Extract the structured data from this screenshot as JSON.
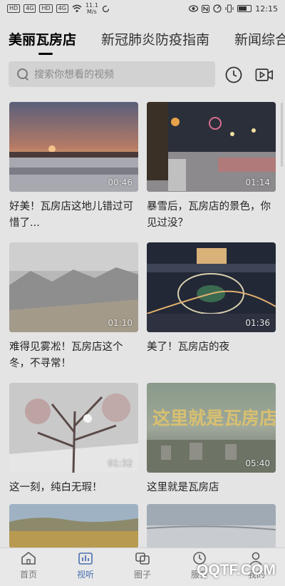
{
  "status_bar": {
    "left_chips": [
      "HD",
      "4G",
      "HD",
      "4G"
    ],
    "speed_value": "11.1",
    "speed_unit": "M/s",
    "time": "12:15"
  },
  "tabs": [
    {
      "label": "美丽瓦房店",
      "active": true
    },
    {
      "label": "新冠肺炎防疫指南",
      "active": false
    },
    {
      "label": "新闻综合",
      "active": false
    }
  ],
  "search": {
    "placeholder": "搜索你想看的视频"
  },
  "videos": [
    {
      "caption": "好美！瓦房店这地儿错过可惜了...",
      "duration": "00:46",
      "scene": "sunset-snow"
    },
    {
      "caption": "暴雪后，瓦房店的景色，你见过没？",
      "duration": "01:14",
      "scene": "night-snow-street"
    },
    {
      "caption": "难得见雾凇！瓦房店这个冬，不寻常！",
      "duration": "01:10",
      "scene": "frost-trees"
    },
    {
      "caption": "美了！瓦房店的夜",
      "duration": "01:36",
      "scene": "night-city"
    },
    {
      "caption": "这一刻，纯白无瑕！",
      "duration": "01:32",
      "scene": "frost-branches"
    },
    {
      "caption": "这里就是瓦房店",
      "duration": "05:40",
      "scene": "city-overlook",
      "overlay_text": "这里就是瓦房店"
    },
    {
      "caption": "",
      "duration": "",
      "scene": "fields"
    },
    {
      "caption": "",
      "duration": "",
      "scene": "sea-sky"
    }
  ],
  "bottom_nav": [
    {
      "label": "首页",
      "icon": "home-icon",
      "active": false
    },
    {
      "label": "视听",
      "icon": "chart-icon",
      "active": true
    },
    {
      "label": "圈子",
      "icon": "circle-icon",
      "active": false
    },
    {
      "label": "服务",
      "icon": "clock-icon",
      "active": false
    },
    {
      "label": "我的",
      "icon": "user-icon",
      "active": false
    }
  ],
  "watermark": "QQTF.COM",
  "colors": {
    "background": "#e4e4e4",
    "active_nav": "#4a6fb0"
  }
}
